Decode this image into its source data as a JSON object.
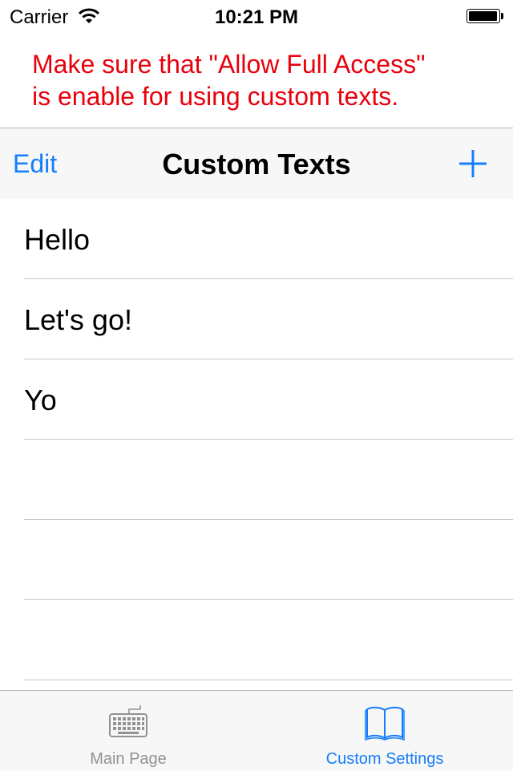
{
  "status_bar": {
    "carrier": "Carrier",
    "time": "10:21 PM",
    "icons": [
      "wifi-icon",
      "battery-icon"
    ]
  },
  "warning": {
    "line1": "Make sure that \"Allow Full Access\"",
    "line2": "is enable for using custom texts.",
    "color": "#e8000b"
  },
  "nav_bar": {
    "edit_label": "Edit",
    "title": "Custom Texts",
    "add_icon": "plus-icon",
    "accent": "#157efb"
  },
  "list": {
    "items": [
      "Hello",
      "Let's go!",
      "Yo",
      "",
      "",
      ""
    ]
  },
  "tab_bar": {
    "tabs": [
      {
        "label": "Main Page",
        "icon": "keyboard-icon",
        "selected": false
      },
      {
        "label": "Custom Settings",
        "icon": "book-icon",
        "selected": true
      }
    ]
  }
}
